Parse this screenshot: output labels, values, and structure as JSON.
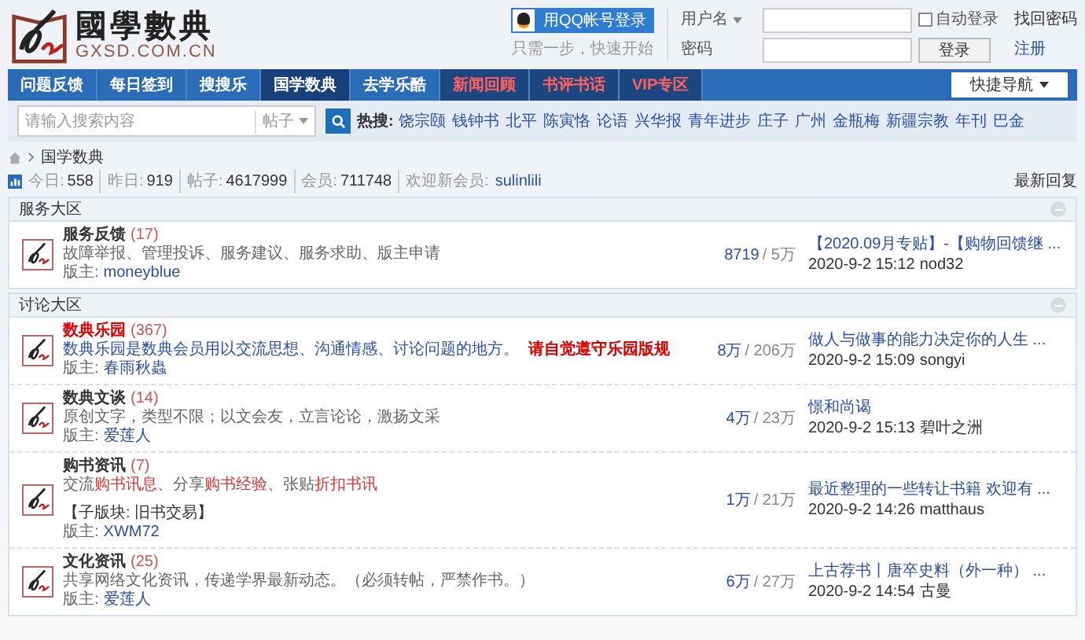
{
  "logo": {
    "title": "國學數典",
    "domain": "GXSD.COM.CN"
  },
  "qq_login": {
    "button": "用QQ帐号登录",
    "hint": "只需一步，快速开始"
  },
  "login": {
    "username_label": "用户名",
    "password_label": "密码",
    "auto_login": {
      "label": "自动登录",
      "checked": false
    },
    "forgot": "找回密码",
    "submit": "登录",
    "register": "注册"
  },
  "nav": [
    {
      "label": "问题反馈",
      "selected": false,
      "kind": "normal"
    },
    {
      "label": "每日签到",
      "selected": false,
      "kind": "normal"
    },
    {
      "label": "搜搜乐",
      "selected": false,
      "kind": "normal"
    },
    {
      "label": "国学数典",
      "selected": true,
      "kind": "normal"
    },
    {
      "label": "去学乐酷",
      "selected": false,
      "kind": "normal"
    },
    {
      "label": "新闻回顾",
      "selected": false,
      "kind": "highlight"
    },
    {
      "label": "书评书话",
      "selected": false,
      "kind": "highlight"
    },
    {
      "label": "VIP专区",
      "selected": false,
      "kind": "highlight"
    }
  ],
  "quick_nav": "快捷导航",
  "search": {
    "placeholder": "请输入搜索内容",
    "scope": "帖子",
    "hot_label": "热搜:",
    "hot": [
      "饶宗颐",
      "钱钟书",
      "北平",
      "陈寅恪",
      "论语",
      "兴华报",
      "青年进步",
      "庄子",
      "广州",
      "金瓶梅",
      "新疆宗教",
      "年刊",
      "巴金"
    ]
  },
  "breadcrumb": [
    "国学数典"
  ],
  "stats": [
    {
      "label": "今日:",
      "value": "558"
    },
    {
      "label": "昨日:",
      "value": "919"
    },
    {
      "label": "帖子:",
      "value": "4617999"
    },
    {
      "label": "会员:",
      "value": "711748"
    }
  ],
  "welcome": {
    "label": "欢迎新会员:",
    "user": "sulinlili"
  },
  "latest_replies": "最新回复",
  "sections": [
    {
      "title": "服务大区",
      "forums": [
        {
          "name": "服务反馈",
          "count": "(17)",
          "hot": false,
          "desc": [
            {
              "kind": "normal",
              "text": "故障举报、管理投诉、服务建议、服务求助、版主申请"
            }
          ],
          "moderator_label": "版主:",
          "moderator": "moneyblue",
          "threads": "8719",
          "posts": "/ 5万",
          "last_title": "【2020.09月专贴】-【购物回馈继 ...",
          "last_time": "2020-9-2 15:12",
          "last_user": "nod32"
        }
      ]
    },
    {
      "title": "讨论大区",
      "forums": [
        {
          "name": "数典乐园",
          "count": "(367)",
          "hot": true,
          "desc": [
            {
              "kind": "link",
              "text": "数典乐园是数典会员用以交流思想、沟通情感、讨论问题的地方。"
            },
            {
              "kind": "alert",
              "text": "请自觉遵守乐园版规"
            }
          ],
          "moderator_label": "版主:",
          "moderator": "春雨秋蟲",
          "threads": "8万",
          "posts": "/ 206万",
          "last_title": "做人与做事的能力决定你的人生 ...",
          "last_time": "2020-9-2 15:09",
          "last_user": "songyi"
        },
        {
          "name": "数典文谈",
          "count": "(14)",
          "hot": false,
          "desc": [
            {
              "kind": "normal",
              "text": "原创文字，类型不限；以文会友，立言论论，激扬文采"
            }
          ],
          "moderator_label": "版主:",
          "moderator": "爱莲人",
          "threads": "4万",
          "posts": "/ 23万",
          "last_title": "憬和尚谒",
          "last_time": "2020-9-2 15:13",
          "last_user": "碧叶之洲"
        },
        {
          "name": "购书资讯",
          "count": "(7)",
          "hot": false,
          "desc": [
            {
              "kind": "normal",
              "text": "交流"
            },
            {
              "kind": "red",
              "text": "购书讯息"
            },
            {
              "kind": "normal",
              "text": "、分享"
            },
            {
              "kind": "red",
              "text": "购书经验"
            },
            {
              "kind": "normal",
              "text": "、张贴"
            },
            {
              "kind": "red",
              "text": "折扣书讯"
            }
          ],
          "subforum": "【子版块: 旧书交易】",
          "moderator_label": "版主:",
          "moderator": "XWM72",
          "threads": "1万",
          "posts": "/ 21万",
          "last_title": "最近整理的一些转让书籍 欢迎有 ...",
          "last_time": "2020-9-2 14:26",
          "last_user": "matthaus"
        },
        {
          "name": "文化资讯",
          "count": "(25)",
          "hot": false,
          "desc": [
            {
              "kind": "normal",
              "text": "共享网络文化资讯，传递学界最新动态。（必须转帖，严禁作书。）"
            }
          ],
          "moderator_label": "版主:",
          "moderator": "爱莲人",
          "threads": "6万",
          "posts": "/ 27万",
          "last_title": "上古荐书丨唐卒史料（外一种） ...",
          "last_time": "2020-9-2 14:54",
          "last_user": "古曼"
        }
      ]
    }
  ]
}
